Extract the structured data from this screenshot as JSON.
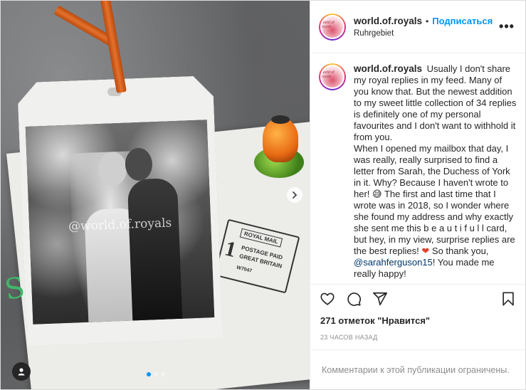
{
  "post": {
    "username": "world.of.royals",
    "bullet": "•",
    "follow_label": "Подписаться",
    "location": "Ruhrgebiet",
    "more_label": "•••",
    "avatar_text": "world of royals"
  },
  "media": {
    "watermark": "@world.of.royals",
    "stamp": {
      "title": "ROYAL MAIL",
      "class": "1",
      "line1": "POSTAGE PAID",
      "line2": "GREAT BRITAIN",
      "number": "W7047"
    },
    "green_mark": "S",
    "dots_total": 3,
    "active_dot": 0
  },
  "caption": {
    "p1": "Usually I don't share my royal replies in my feed. Many of you know that. But the newest addition to my sweet little collection of 34 replies is definitely one of my personal favourites and I don't want to withhold it from you.",
    "p2a": "When I opened my mailbox that day, I was really, really surprised to find a letter from Sarah, the Duchess of York in it. Why? Because I haven't wrote to her! ",
    "emoji_grin": "😅",
    "p2b": " The first and last time that I wrote was in 2018, so I wonder where she found my address and why exactly she sent me this b e a u t i f u l l card, but hey, in my view, surprise replies are the best replies! ",
    "emoji_heart": "❤",
    "p2c": " So thank you, ",
    "mention": "@sarahferguson15",
    "p2d": "! You made me really happy!"
  },
  "stats": {
    "likes": "271 отметок \"Нравится\"",
    "time": "23 ЧАСОВ НАЗАД"
  },
  "comment_bar": {
    "text": "Комментарии к этой публикации ограничены."
  },
  "icons": {
    "like": "heart-icon",
    "comment": "comment-icon",
    "share": "share-icon",
    "save": "bookmark-icon",
    "next": "chevron-right-icon",
    "user_tag": "user-icon"
  }
}
